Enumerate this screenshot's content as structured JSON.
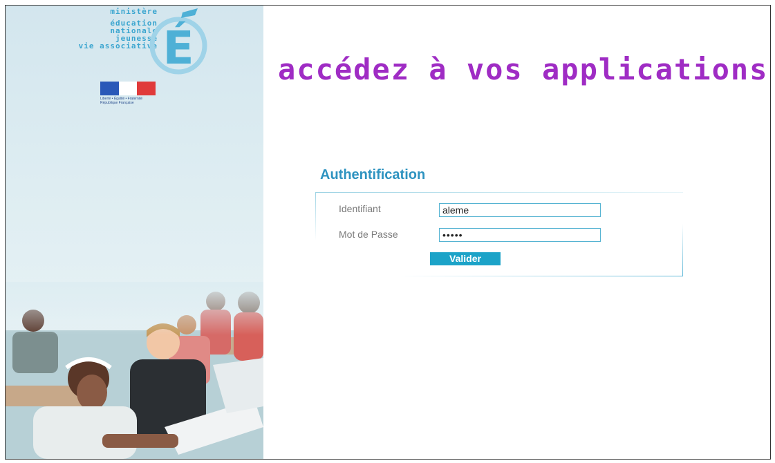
{
  "sidebar": {
    "ministry_lines": [
      "ministère",
      "éducation",
      "nationale",
      "jeunesse",
      "vie associative"
    ],
    "logo_letter": "É",
    "flag_caption_lines": [
      "Liberté • Égalité • Fraternité",
      "République Française"
    ]
  },
  "headline": "accédez à vos applications",
  "auth": {
    "title": "Authentification",
    "username_label": "Identifiant",
    "username_value": "aleme",
    "password_label": "Mot de Passe",
    "password_value": "•••••",
    "submit_label": "Valider"
  },
  "colors": {
    "headline": "#9f2cc4",
    "title": "#2e93c0",
    "button": "#1ca3c8",
    "input_border": "#55b3d2",
    "logo": "#3aa5cf"
  }
}
